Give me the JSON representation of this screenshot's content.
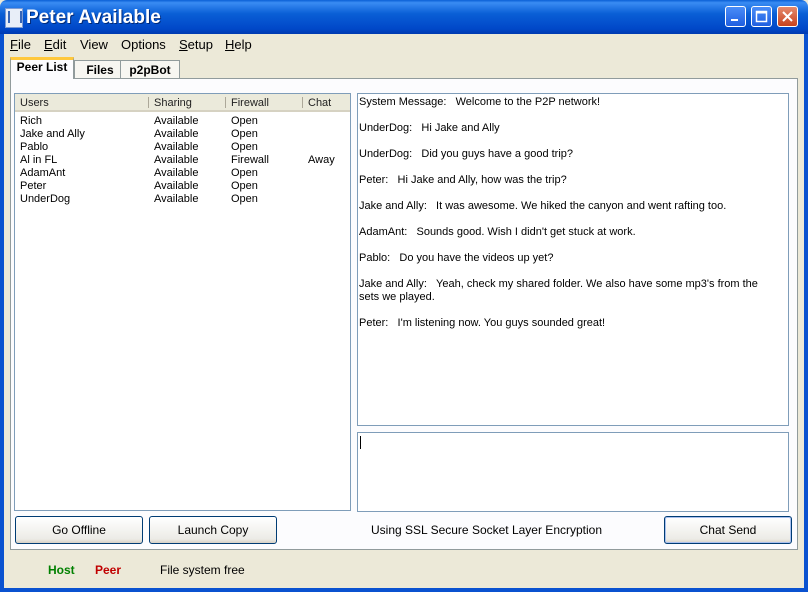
{
  "window": {
    "title": "Peter Available"
  },
  "menu": [
    {
      "label": "File",
      "mnemonic": "F",
      "rest": "ile"
    },
    {
      "label": "Edit",
      "mnemonic": "E",
      "rest": "dit"
    },
    {
      "label": "View",
      "mnemonic": "",
      "rest": "View"
    },
    {
      "label": "Options",
      "mnemonic": "",
      "rest": "Options"
    },
    {
      "label": "Setup",
      "mnemonic": "S",
      "rest": "etup"
    },
    {
      "label": "Help",
      "mnemonic": "H",
      "rest": "elp"
    }
  ],
  "tabs": [
    "Peer List",
    "Files",
    "p2pBot"
  ],
  "peer_table": {
    "columns": [
      "Users",
      "Sharing",
      "Firewall",
      "Chat"
    ],
    "rows": [
      [
        "Rich",
        "Available",
        "Open",
        ""
      ],
      [
        "Jake and Ally",
        "Available",
        "Open",
        ""
      ],
      [
        "Pablo",
        "Available",
        "Open",
        ""
      ],
      [
        "Al in FL",
        "Available",
        "Firewall",
        "Away"
      ],
      [
        "AdamAnt",
        "Available",
        "Open",
        ""
      ],
      [
        "Peter",
        "Available",
        "Open",
        ""
      ],
      [
        "UnderDog",
        "Available",
        "Open",
        ""
      ]
    ]
  },
  "chat_messages": [
    {
      "sender": "System Message:",
      "text": "Welcome to the P2P network!"
    },
    {
      "sender": "UnderDog:",
      "text": "Hi Jake and Ally"
    },
    {
      "sender": "UnderDog:",
      "text": "Did you guys have a good trip?"
    },
    {
      "sender": "Peter:",
      "text": "Hi Jake and Ally, how was the trip?"
    },
    {
      "sender": "Jake and Ally:",
      "text": "It was awesome. We hiked the canyon and went rafting too."
    },
    {
      "sender": "AdamAnt:",
      "text": "Sounds good. Wish I didn't get stuck at work."
    },
    {
      "sender": "Pablo:",
      "text": "Do you have the videos up yet?"
    },
    {
      "sender": "Jake and Ally:",
      "text": "Yeah, check my shared folder. We also have some mp3's from the sets we played."
    },
    {
      "sender": "Peter:",
      "text": "I'm listening now. You guys sounded great!"
    }
  ],
  "chat_input": {
    "value": ""
  },
  "buttons": {
    "go_offline": "Go Offline",
    "launch_copy": "Launch Copy",
    "chat_send": "Chat Send"
  },
  "encryption_text": "Using SSL Secure Socket Layer Encryption",
  "status": {
    "host": {
      "label": "Host",
      "color": "#008000"
    },
    "peer": {
      "label": "Peer",
      "color": "#c00000"
    },
    "message": "File system free"
  }
}
